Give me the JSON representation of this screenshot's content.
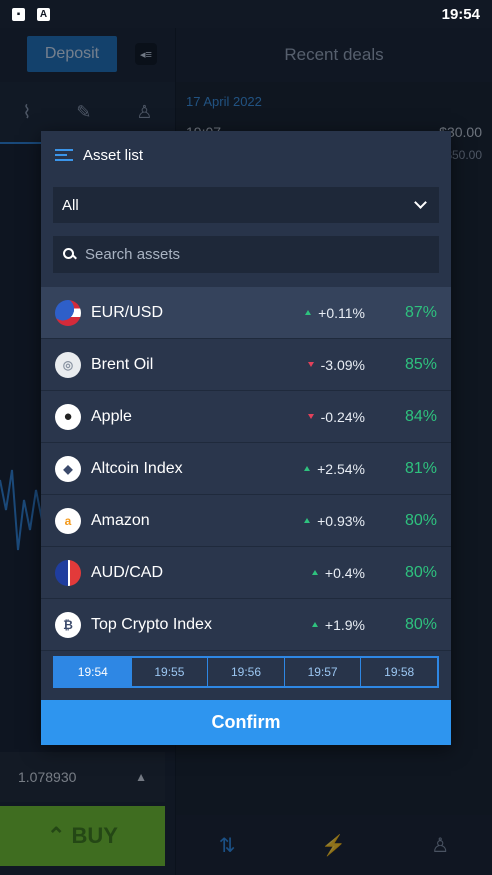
{
  "status_bar": {
    "time": "19:54",
    "icons": [
      "image-icon",
      "text-app-icon"
    ]
  },
  "background": {
    "deposit_label": "Deposit",
    "recent_deals_title": "Recent deals",
    "recent_date": "17 April 2022",
    "recent_time": "19:07",
    "recent_amount": "$30.00",
    "recent_amount_sub": "$50.00",
    "price_value": "1.078930",
    "buy_label": "BUY"
  },
  "modal": {
    "title": "Asset list",
    "filter": {
      "selected": "All"
    },
    "search": {
      "placeholder": "Search assets",
      "value": ""
    },
    "assets": [
      {
        "name": "EUR/USD",
        "change": "+0.11%",
        "direction": "up",
        "payout": "87%",
        "icon": "eu-us-flag-icon",
        "selected": true
      },
      {
        "name": "Brent Oil",
        "change": "-3.09%",
        "direction": "down",
        "payout": "85%",
        "icon": "oil-icon",
        "selected": false
      },
      {
        "name": "Apple",
        "change": "-0.24%",
        "direction": "down",
        "payout": "84%",
        "icon": "apple-icon",
        "selected": false
      },
      {
        "name": "Altcoin Index",
        "change": "+2.54%",
        "direction": "up",
        "payout": "81%",
        "icon": "ethereum-icon",
        "selected": false
      },
      {
        "name": "Amazon",
        "change": "+0.93%",
        "direction": "up",
        "payout": "80%",
        "icon": "amazon-icon",
        "selected": false
      },
      {
        "name": "AUD/CAD",
        "change": "+0.4%",
        "direction": "up",
        "payout": "80%",
        "icon": "au-ca-flag-icon",
        "selected": false
      },
      {
        "name": "Top Crypto Index",
        "change": "+1.9%",
        "direction": "up",
        "payout": "80%",
        "icon": "bitcoin-icon",
        "selected": false
      }
    ],
    "times": [
      "19:54",
      "19:55",
      "19:56",
      "19:57",
      "19:58"
    ],
    "active_time": "19:54",
    "confirm_label": "Confirm"
  },
  "colors": {
    "accent": "#2e95ef",
    "up": "#2ec27e",
    "down": "#e2415a",
    "buy": "#6fbf2e"
  }
}
